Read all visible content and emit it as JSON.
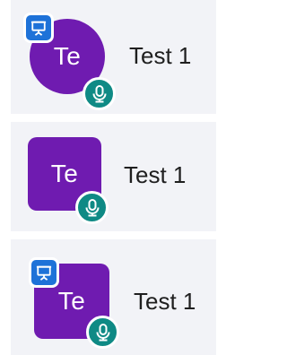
{
  "participants": [
    {
      "initials": "Te",
      "name": "Test 1",
      "avatar_shape": "circle",
      "presenting": true,
      "mic_icon": "microphone-icon",
      "present_icon": "presentation-icon"
    },
    {
      "initials": "Te",
      "name": "Test 1",
      "avatar_shape": "rounded-square",
      "presenting": false,
      "mic_icon": "microphone-icon"
    },
    {
      "initials": "Te",
      "name": "Test 1",
      "avatar_shape": "rounded-square",
      "presenting": true,
      "mic_icon": "microphone-icon",
      "present_icon": "presentation-icon"
    }
  ],
  "colors": {
    "avatar": "#6f1bb0",
    "mic_badge": "#0f8a85",
    "present_badge": "#1e72d8",
    "card_bg": "#f2f3f7"
  }
}
